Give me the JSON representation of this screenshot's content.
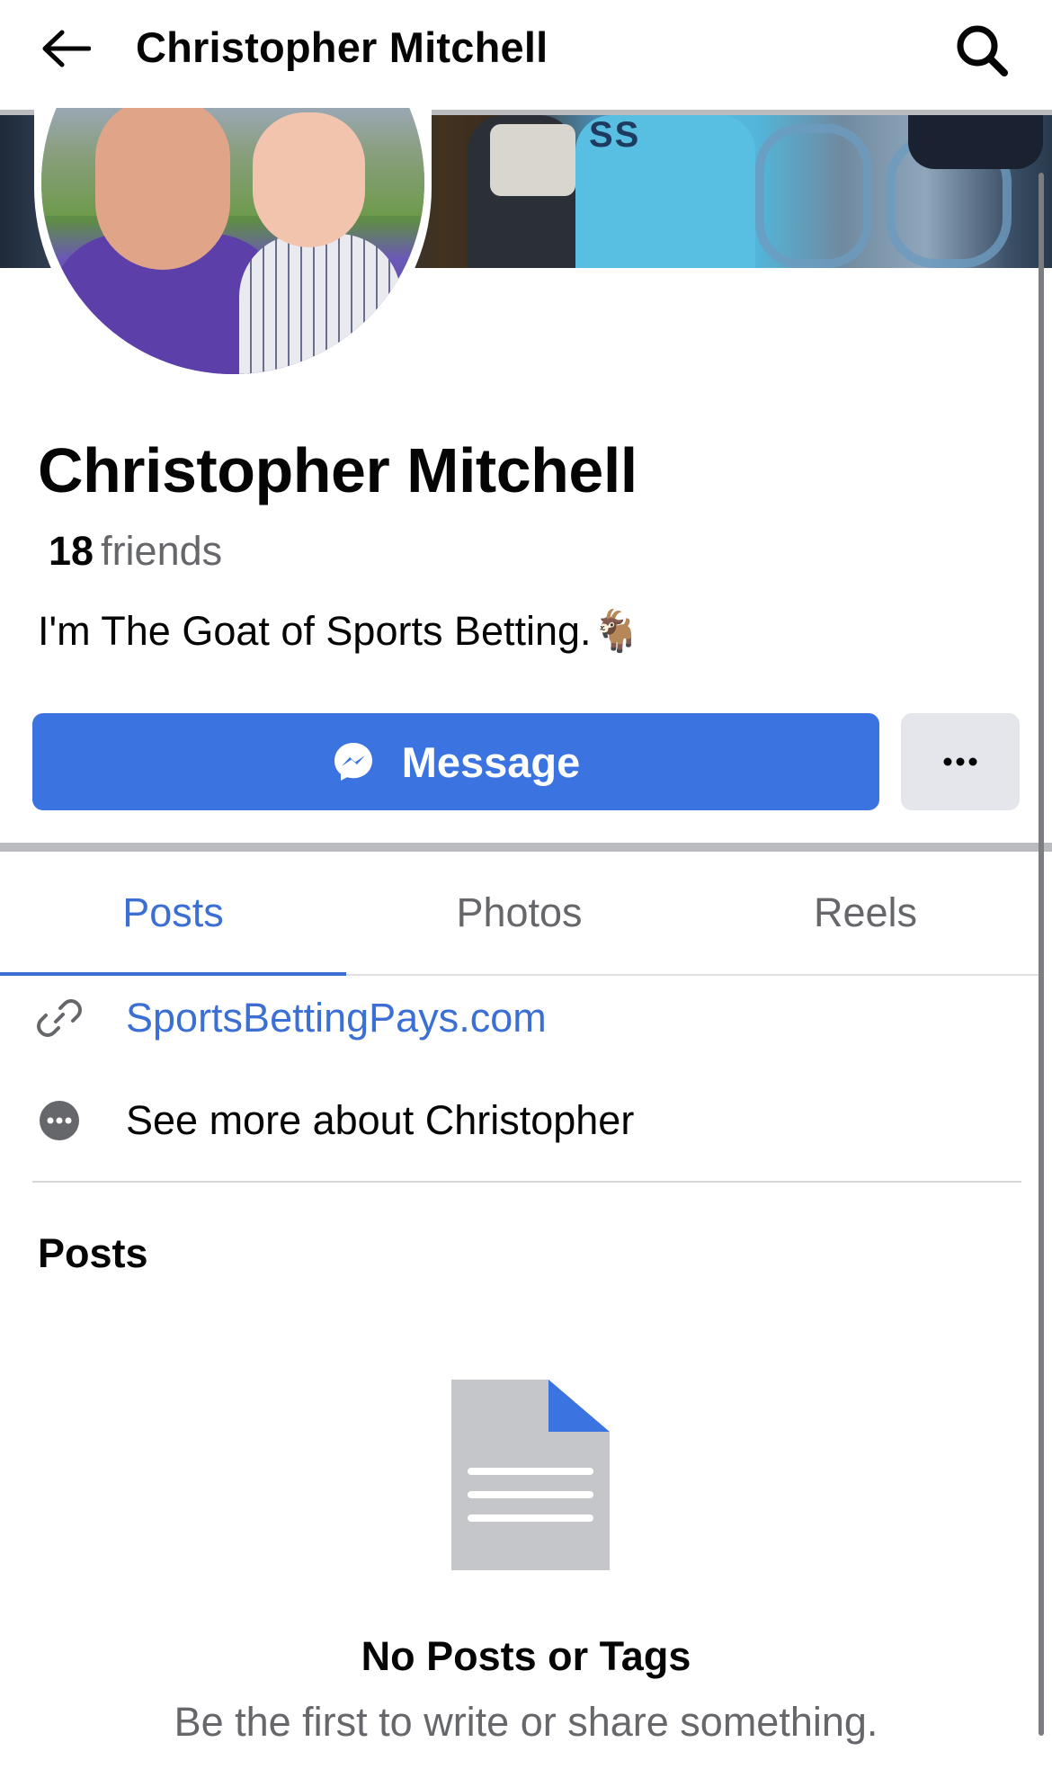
{
  "header": {
    "title": "Christopher Mitchell",
    "back_icon": "arrow-left-icon",
    "search_icon": "search-icon"
  },
  "cover": {
    "shirt_text": "SS"
  },
  "profile": {
    "name": "Christopher Mitchell",
    "friends_count": "18",
    "friends_label": "friends",
    "bio": "I'm The Goat of Sports Betting.🐐"
  },
  "actions": {
    "message_label": "Message",
    "message_icon": "messenger-icon",
    "more_icon": "ellipsis-icon"
  },
  "tabs": [
    {
      "label": "Posts",
      "active": true
    },
    {
      "label": "Photos",
      "active": false
    },
    {
      "label": "Reels",
      "active": false
    }
  ],
  "about": {
    "link": "SportsBettingPays.com",
    "see_more": "See more about Christopher"
  },
  "posts": {
    "heading": "Posts",
    "empty_title": "No Posts or Tags",
    "empty_subtitle": "Be the first to write or share something."
  },
  "colors": {
    "accent": "#3b74e0",
    "link": "#3b6fd4",
    "secondary_text": "#65676b",
    "button_gray": "#e4e6eb"
  }
}
